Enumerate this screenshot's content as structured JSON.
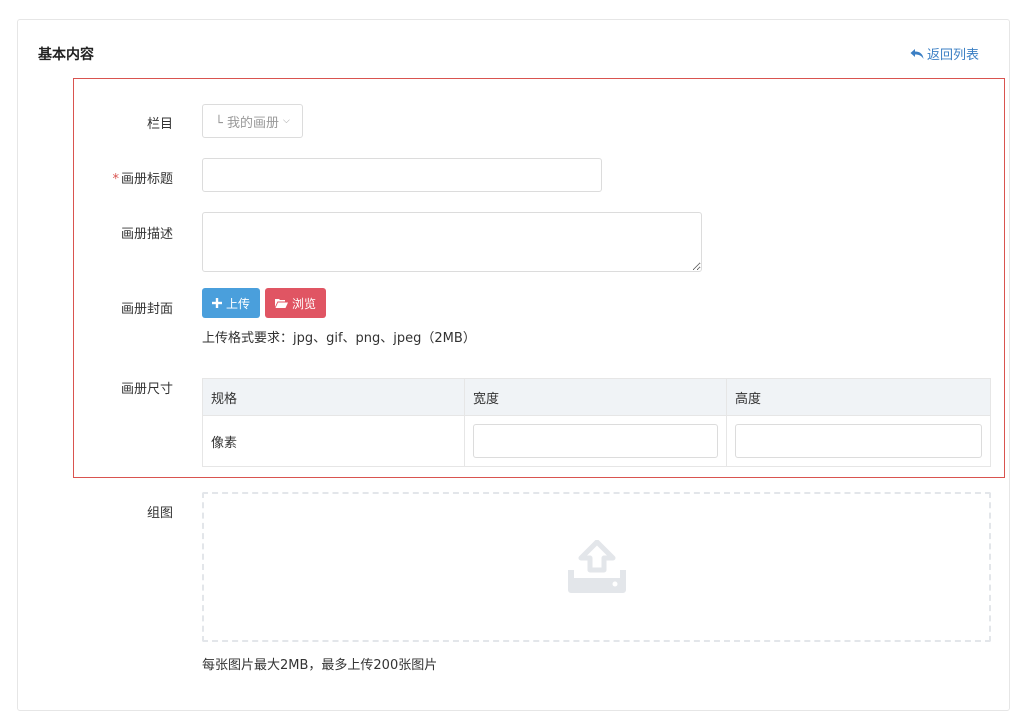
{
  "panel": {
    "title": "基本内容",
    "back_label": "返回列表"
  },
  "form": {
    "category": {
      "label": "栏目",
      "value": "└ 我的画册"
    },
    "title": {
      "required_mark": "*",
      "label": "画册标题",
      "value": ""
    },
    "description": {
      "label": "画册描述",
      "value": ""
    },
    "cover": {
      "label": "画册封面",
      "upload_label": "上传",
      "browse_label": "浏览",
      "hint": "上传格式要求：jpg、gif、png、jpeg（2MB）"
    },
    "size": {
      "label": "画册尺寸",
      "headers": [
        "规格",
        "宽度",
        "高度"
      ],
      "rows": [
        {
          "spec": "像素",
          "width": "",
          "height": ""
        }
      ]
    },
    "gallery": {
      "label": "组图",
      "hint": "每张图片最大2MB，最多上传200张图片"
    }
  },
  "colors": {
    "accent_blue": "#4a9fdc",
    "accent_red": "#e05563",
    "link": "#3b7fc4",
    "highlight_border": "#d9534f"
  },
  "icons": {
    "back": "reply-arrow-icon",
    "upload": "plus-icon",
    "browse": "folder-open-icon",
    "dropzone": "upload-tray-icon"
  }
}
